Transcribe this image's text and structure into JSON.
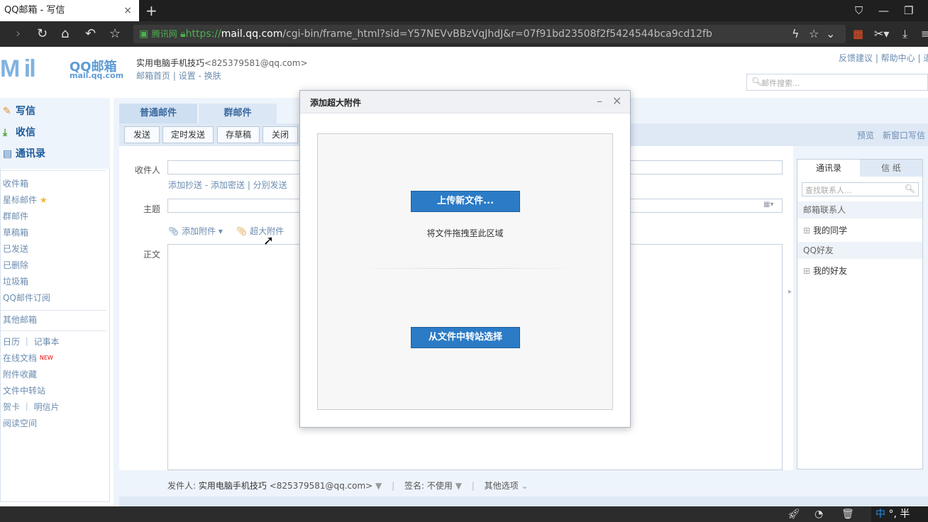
{
  "browser": {
    "tab_title": "QQ邮箱 - 写信",
    "tab_close": "×",
    "new_tab": "+",
    "url_secure_label": "腾讯网",
    "url_scheme": "https://",
    "url_host": "mail.qq.com",
    "url_path": "/cgi-bin/frame_html?sid=Y57NEVvBBzVqJhdJ&r=07f91bd23508f2f5424544bca9cd12fb"
  },
  "header": {
    "logo_text": "M il",
    "logo_qq": "QQ邮箱",
    "logo_domain": "mail.qq.com",
    "user_name": "实用电脑手机技巧",
    "user_email": "<825379581@qq.com>",
    "links": [
      "邮箱首页",
      "设置",
      "换肤"
    ],
    "right_links": "反馈建议 | 帮助中心 | 退",
    "search_placeholder": "邮件搜索..."
  },
  "sidebar": {
    "primary": [
      {
        "label": "写信",
        "icon": "compose-icon"
      },
      {
        "label": "收信",
        "icon": "inbox-icon"
      },
      {
        "label": "通讯录",
        "icon": "contacts-icon"
      }
    ],
    "folders": [
      "收件箱",
      "星标邮件",
      "群邮件",
      "草稿箱",
      "已发送",
      "已删除",
      "垃圾箱",
      "QQ邮件订阅"
    ],
    "other": "其他邮箱",
    "tools": {
      "calendar": "日历",
      "notebook": "记事本",
      "docs": "在线文档",
      "docs_badge": "NEW",
      "attach_fav": "附件收藏",
      "transfer": "文件中转站",
      "card": "贺卡",
      "postcard": "明信片",
      "reading": "阅读空间"
    }
  },
  "compose": {
    "tabs": [
      "普通邮件",
      "群邮件"
    ],
    "toolbar": [
      "发送",
      "定时发送",
      "存草稿",
      "关闭"
    ],
    "right_actions": [
      "预览",
      "新窗口写信"
    ],
    "to_label": "收件人",
    "to_links": [
      "添加抄送",
      "添加密送",
      "分别发送"
    ],
    "subject_label": "主题",
    "attach_label": "添加附件",
    "big_attach_label": "超大附件",
    "body_label": "正文",
    "footer": {
      "sender_label": "发件人:",
      "sender_name": "实用电脑手机技巧",
      "sender_email": "<825379581@qq.com>",
      "signature_label": "签名:",
      "signature_value": "不使用",
      "other_options": "其他选项"
    }
  },
  "right_panel": {
    "tabs": [
      "通讯录",
      "信 纸"
    ],
    "search_placeholder": "查找联系人...",
    "groups": [
      {
        "title": "邮箱联系人",
        "items": [
          "我的同学"
        ]
      },
      {
        "title": "QQ好友",
        "items": [
          "我的好友"
        ]
      }
    ]
  },
  "dialog": {
    "title": "添加超大附件",
    "upload_button": "上传新文件...",
    "drag_hint": "将文件拖拽至此区域",
    "transfer_button": "从文件中转站选择"
  },
  "taskbar": {
    "ime_label": "中",
    "ime_extra": "°, 半"
  }
}
